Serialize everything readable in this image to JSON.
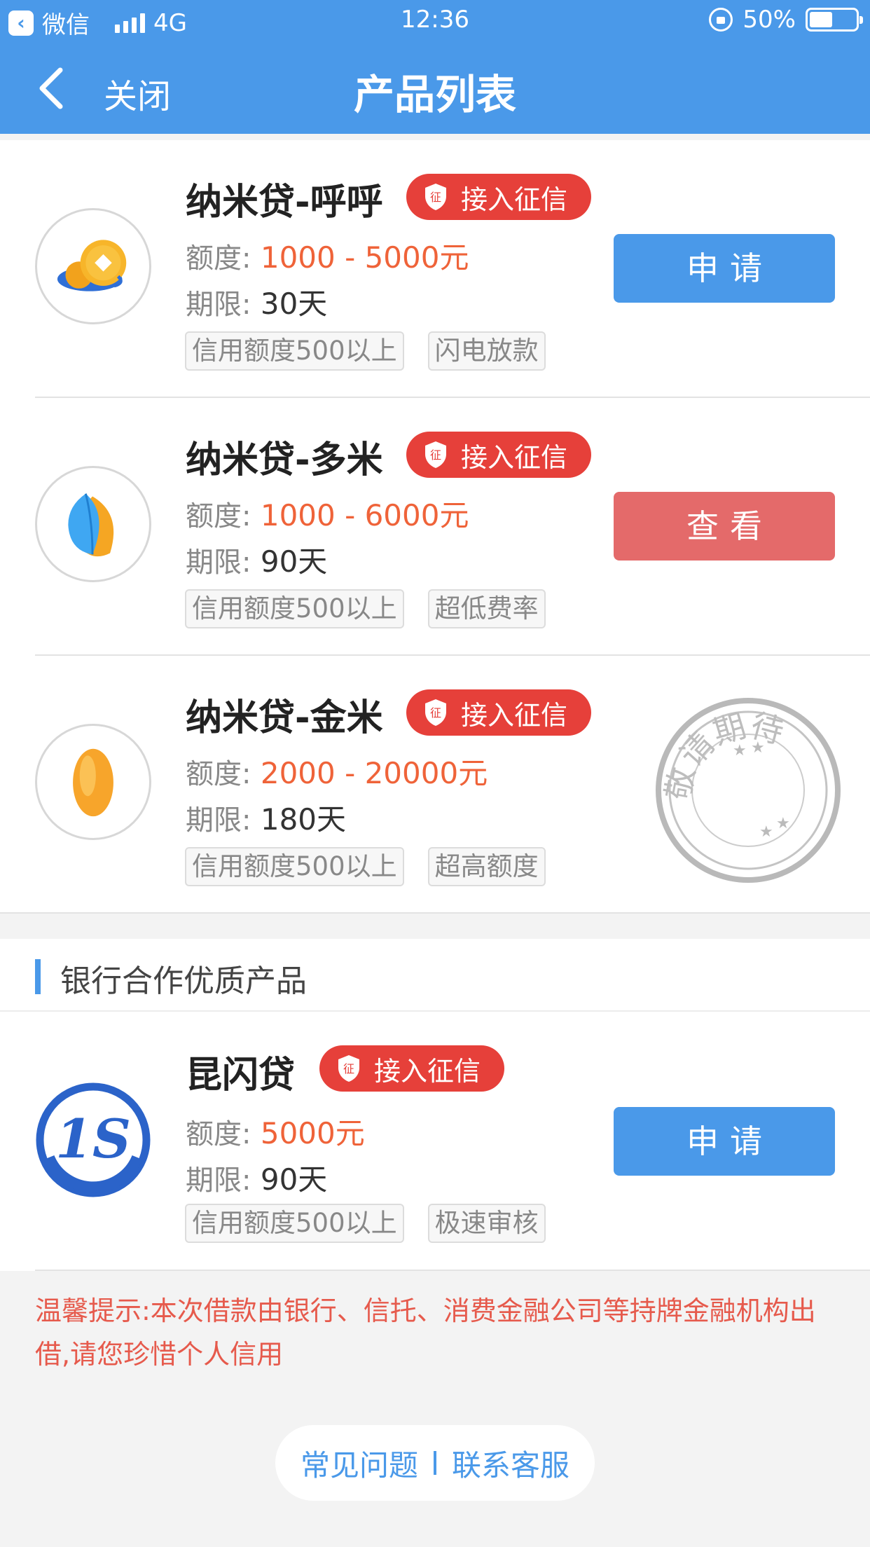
{
  "status_bar": {
    "back_app": "微信",
    "network": "4G",
    "time": "12:36",
    "battery": "50%",
    "battery_level": 0.5
  },
  "nav": {
    "close_label": "关闭",
    "title": "产品列表"
  },
  "products": [
    {
      "name": "纳米贷-呼呼",
      "badge": "接入征信",
      "amount_label": "额度:",
      "amount": "1000 - 5000元",
      "term_label": "期限:",
      "term": "30天",
      "tags": [
        "信用额度500以上",
        "闪电放款"
      ],
      "action": "申请",
      "action_style": "blue",
      "logo_icon": "coin-icon"
    },
    {
      "name": "纳米贷-多米",
      "badge": "接入征信",
      "amount_label": "额度:",
      "amount": "1000 - 6000元",
      "term_label": "期限:",
      "term": "90天",
      "tags": [
        "信用额度500以上",
        "超低费率"
      ],
      "action": "查看",
      "action_style": "red",
      "logo_icon": "leaf-icon"
    },
    {
      "name": "纳米贷-金米",
      "badge": "接入征信",
      "amount_label": "额度:",
      "amount": "2000 - 20000元",
      "term_label": "期限:",
      "term": "180天",
      "tags": [
        "信用额度500以上",
        "超高额度"
      ],
      "stamp": "敬请期待",
      "logo_icon": "rice-grain-icon"
    }
  ],
  "section": {
    "title": "银行合作优质产品"
  },
  "bank_product": {
    "name": "昆闪贷",
    "badge": "接入征信",
    "amount_label": "额度:",
    "amount": "5000元",
    "term_label": "期限:",
    "term": "90天",
    "tags": [
      "信用额度500以上",
      "极速审核"
    ],
    "action": "申请",
    "logo_text": "1S"
  },
  "notice": "温馨提示:本次借款由银行、信托、消费金融公司等持牌金融机构出借,请您珍惜个人信用",
  "footer": {
    "faq": "常见问题",
    "contact": "联系客服"
  }
}
